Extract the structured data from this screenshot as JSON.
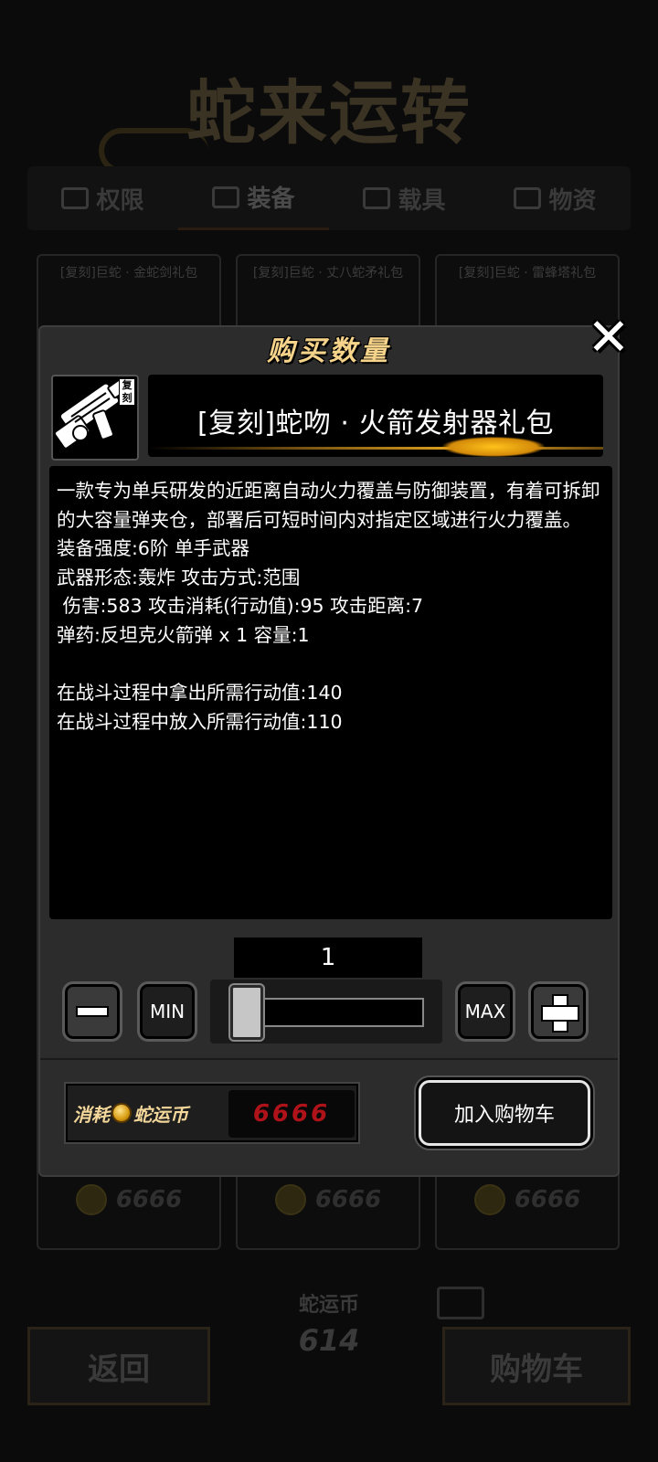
{
  "background": {
    "logo": "蛇来运转",
    "tabs": [
      "权限",
      "装备",
      "载具",
      "物资"
    ],
    "active_tab": "装备",
    "cards": [
      {
        "title": "[复刻]巨蛇 · 金蛇剑礼包",
        "price": "6666"
      },
      {
        "title": "[复刻]巨蛇 · 丈八蛇矛礼包",
        "price": "6666"
      },
      {
        "title": "[复刻]巨蛇 · 雷蜂塔礼包",
        "price": "6666"
      }
    ],
    "back_label": "返回",
    "balance_label": "蛇运币",
    "balance_value": "614",
    "cart_label": "购物车"
  },
  "dialog": {
    "title": "购买数量",
    "item_badge": "复刻",
    "item_name": "[复刻]蛇吻 · 火箭发射器礼包",
    "description": "一款专为单兵研发的近距离自动火力覆盖与防御装置，有着可拆卸的大容量弹夹仓，部署后可短时间内对指定区域进行火力覆盖。",
    "stats": [
      "装备强度:6阶 单手武器",
      "武器形态:轰炸 攻击方式:范围",
      " 伤害:583 攻击消耗(行动值):95 攻击距离:7",
      "弹药:反坦克火箭弹 x 1 容量:1",
      "",
      "在战斗过程中拿出所需行动值:140",
      "在战斗过程中放入所需行动值:110"
    ],
    "quantity": "1",
    "min_label": "MIN",
    "max_label": "MAX",
    "slider_level": 0.0,
    "cost_label_prefix": "消耗",
    "cost_label_suffix": "蛇运币",
    "cost_value": "6666",
    "add_to_cart_label": "加入购物车"
  },
  "colors": {
    "title_gold": "#f5d38a",
    "cost_red": "#b0121a",
    "panel": "#2c2c2c"
  }
}
